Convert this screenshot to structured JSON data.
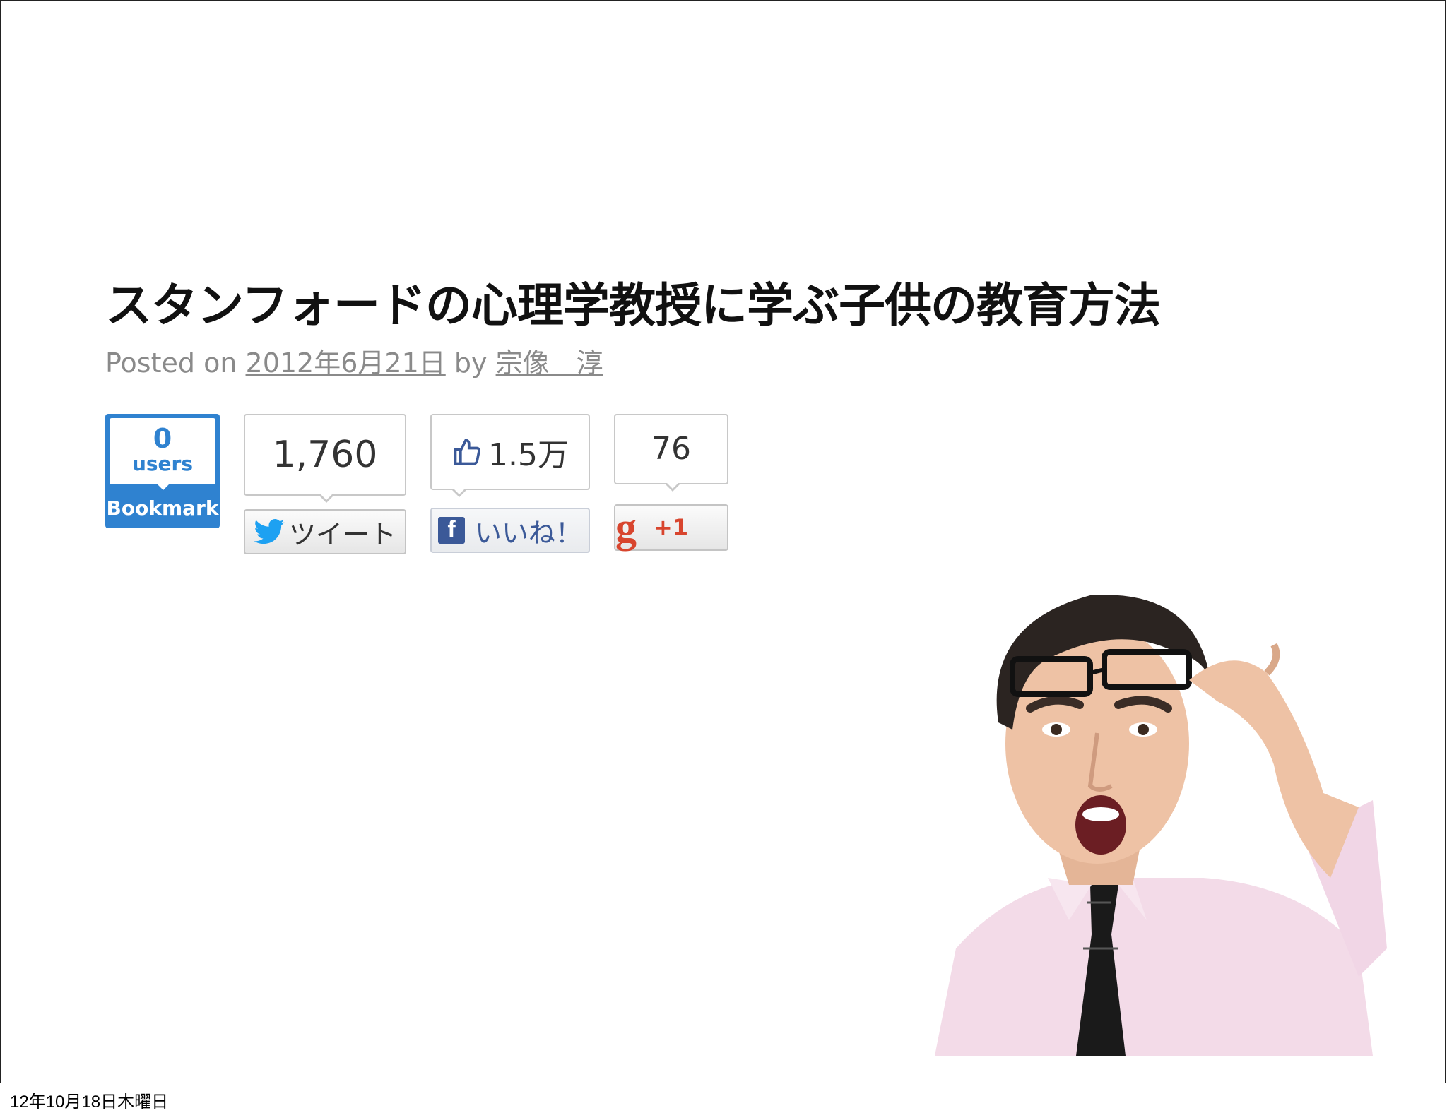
{
  "article": {
    "title": "スタンフォードの心理学教授に学ぶ子供の教育方法",
    "posted_on_label": "Posted on",
    "date": "2012年6月21日",
    "by_label": "by",
    "author": "宗像　淳"
  },
  "social": {
    "hatena": {
      "count": "0",
      "unit": "users",
      "label": "Bookmark",
      "color": "#2f82d0"
    },
    "twitter": {
      "count": "1,760",
      "button_label": "ツイート",
      "color": "#1da1f2"
    },
    "facebook": {
      "count": "1.5万",
      "button_label": "いいね！",
      "color": "#3b5998"
    },
    "google_plus": {
      "count": "76",
      "button_label": "+1",
      "color": "#d8452e"
    }
  },
  "footer": {
    "timestamp": "12年10月18日木曜日"
  }
}
